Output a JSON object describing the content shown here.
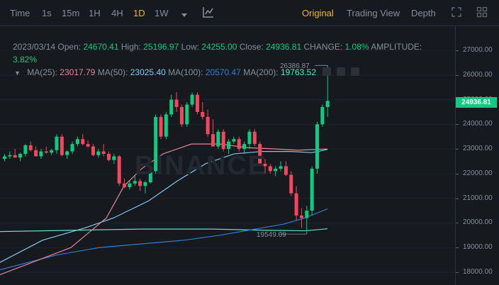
{
  "toolbar": {
    "intervals": [
      "Time",
      "1s",
      "15m",
      "1H",
      "4H",
      "1D",
      "1W"
    ],
    "active_interval": "1D",
    "views": [
      "Original",
      "Trading View",
      "Depth"
    ],
    "active_view": "Original"
  },
  "ohlc": {
    "date": "2023/03/14",
    "open_label": "Open:",
    "open": "24670.41",
    "high_label": "High:",
    "high": "25196.97",
    "low_label": "Low:",
    "low": "24255.00",
    "close_label": "Close:",
    "close": "24936.81",
    "change_label": "CHANGE:",
    "change": "1.08%",
    "amplitude_label": "AMPLITUDE:",
    "amplitude": "3.82%"
  },
  "ma": {
    "ma25_label": "MA(25):",
    "ma25": "23017.79",
    "ma50_label": "MA(50):",
    "ma50": "23025.40",
    "ma100_label": "MA(100):",
    "ma100": "20570.47",
    "ma200_label": "MA(200):",
    "ma200": "19763.52"
  },
  "annotations": {
    "high": "26386.87",
    "low": "19549.09"
  },
  "current_price": "24936.81",
  "watermark": "BINANCE",
  "colors": {
    "up": "#0ecb81",
    "down": "#f6465d",
    "accent": "#f0b90b",
    "ma25": "#e48496",
    "ma50": "#7ec8f4",
    "ma100": "#2f7bd6",
    "ma200": "#5de3c0"
  },
  "chart_data": {
    "type": "candlestick",
    "yticks": [
      "27000.00",
      "26000.00",
      "25000.00",
      "24000.00",
      "23000.00",
      "22000.00",
      "21000.00",
      "20000.00",
      "19000.00",
      "18000.00"
    ],
    "ylim": [
      17800,
      27500
    ],
    "candles": [
      [
        22600,
        22800,
        22500,
        22700
      ],
      [
        22700,
        22900,
        22600,
        22750
      ],
      [
        22750,
        23000,
        22650,
        22650
      ],
      [
        22650,
        22850,
        22500,
        22800
      ],
      [
        22800,
        23200,
        22700,
        23150
      ],
      [
        23150,
        23300,
        22900,
        22950
      ],
      [
        22950,
        23100,
        22700,
        22700
      ],
      [
        22700,
        23000,
        22600,
        22900
      ],
      [
        22900,
        23100,
        22800,
        22850
      ],
      [
        22850,
        23000,
        22750,
        22950
      ],
      [
        22950,
        23600,
        22800,
        23500
      ],
      [
        23500,
        23600,
        22700,
        22750
      ],
      [
        22750,
        22950,
        22600,
        22900
      ],
      [
        22900,
        23300,
        22800,
        23200
      ],
      [
        23200,
        23500,
        23100,
        23400
      ],
      [
        23400,
        23600,
        23150,
        23200
      ],
      [
        23200,
        23350,
        23050,
        23100
      ],
      [
        23100,
        23200,
        22700,
        22750
      ],
      [
        22750,
        23000,
        22650,
        22900
      ],
      [
        22900,
        23200,
        22700,
        22800
      ],
      [
        22800,
        22900,
        22500,
        22550
      ],
      [
        22550,
        22800,
        22400,
        22700
      ],
      [
        22700,
        22750,
        21500,
        21600
      ],
      [
        21600,
        21800,
        21400,
        21450
      ],
      [
        21450,
        21700,
        21350,
        21600
      ],
      [
        21600,
        21900,
        21500,
        21700
      ],
      [
        21700,
        21800,
        21300,
        21500
      ],
      [
        21500,
        21700,
        21200,
        21650
      ],
      [
        21650,
        22200,
        21600,
        22100
      ],
      [
        22100,
        24400,
        22000,
        24300
      ],
      [
        24300,
        24400,
        23400,
        23500
      ],
      [
        23500,
        24500,
        23400,
        24400
      ],
      [
        24400,
        25200,
        24300,
        25000
      ],
      [
        25000,
        25300,
        24500,
        24700
      ],
      [
        24700,
        24800,
        23900,
        24000
      ],
      [
        24000,
        24900,
        23900,
        24800
      ],
      [
        24800,
        25300,
        24700,
        25200
      ],
      [
        25200,
        25300,
        24400,
        24500
      ],
      [
        24500,
        24900,
        24200,
        24300
      ],
      [
        24300,
        24600,
        23500,
        23600
      ],
      [
        23600,
        24200,
        23200,
        23100
      ],
      [
        23100,
        23800,
        23000,
        23700
      ],
      [
        23700,
        23800,
        22900,
        23000
      ],
      [
        23000,
        23400,
        22800,
        23300
      ],
      [
        23300,
        23500,
        23200,
        23400
      ],
      [
        23400,
        23500,
        22900,
        23000
      ],
      [
        23000,
        23300,
        22800,
        23200
      ],
      [
        23200,
        23800,
        23000,
        23700
      ],
      [
        23700,
        23800,
        23100,
        23200
      ],
      [
        23200,
        23300,
        22300,
        22400
      ],
      [
        22400,
        22600,
        22000,
        22300
      ],
      [
        22300,
        22400,
        22000,
        22100
      ],
      [
        22100,
        22300,
        21900,
        22200
      ],
      [
        22200,
        22500,
        22100,
        22300
      ],
      [
        22300,
        22500,
        21900,
        21950
      ],
      [
        21950,
        22100,
        21100,
        21200
      ],
      [
        21200,
        21500,
        20100,
        20300
      ],
      [
        20300,
        20600,
        19800,
        20200
      ],
      [
        20200,
        20700,
        19549.09,
        20500
      ],
      [
        20500,
        22300,
        20300,
        22200
      ],
      [
        22200,
        24100,
        22000,
        24000
      ],
      [
        24000,
        24800,
        23900,
        24700
      ],
      [
        24700,
        26386.87,
        24300,
        24950
      ]
    ],
    "ma25": [
      [
        0,
        17900
      ],
      [
        100,
        19000
      ],
      [
        150,
        20200
      ],
      [
        175,
        21500
      ],
      [
        200,
        22200
      ],
      [
        230,
        22800
      ],
      [
        270,
        23200
      ],
      [
        310,
        23200
      ],
      [
        350,
        23050
      ],
      [
        390,
        23000
      ],
      [
        420,
        22950
      ],
      [
        462,
        23000
      ]
    ],
    "ma50": [
      [
        0,
        18400
      ],
      [
        60,
        19300
      ],
      [
        120,
        19800
      ],
      [
        160,
        20200
      ],
      [
        210,
        20900
      ],
      [
        250,
        21700
      ],
      [
        290,
        22400
      ],
      [
        330,
        22800
      ],
      [
        370,
        22900
      ],
      [
        410,
        22900
      ],
      [
        440,
        22850
      ],
      [
        462,
        22980
      ]
    ],
    "ma100": [
      [
        0,
        18100
      ],
      [
        80,
        18700
      ],
      [
        140,
        19000
      ],
      [
        200,
        19150
      ],
      [
        260,
        19300
      ],
      [
        310,
        19500
      ],
      [
        350,
        19700
      ],
      [
        400,
        19950
      ],
      [
        430,
        20200
      ],
      [
        462,
        20570
      ]
    ],
    "ma200": [
      [
        0,
        19650
      ],
      [
        100,
        19700
      ],
      [
        200,
        19750
      ],
      [
        300,
        19750
      ],
      [
        380,
        19700
      ],
      [
        430,
        19680
      ],
      [
        462,
        19763.52
      ]
    ]
  }
}
